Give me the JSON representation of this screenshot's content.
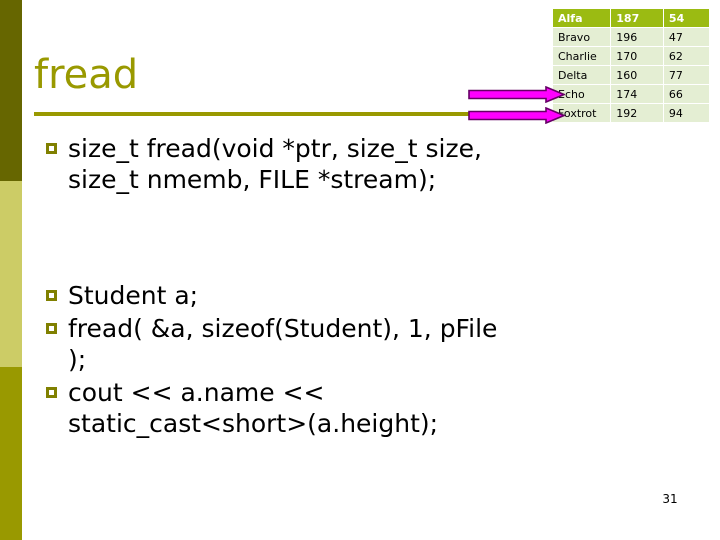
{
  "slide": {
    "title": "fread",
    "page_number": "31"
  },
  "sidebar": {
    "segments": [
      {
        "name": "top",
        "color": "#666600"
      },
      {
        "name": "middle",
        "color": "#CCCC66"
      },
      {
        "name": "bottom",
        "color": "#999900"
      }
    ]
  },
  "content": {
    "groups": [
      {
        "bullets": [
          "size_t fread(void *ptr, size_t size, size_t nmemb, FILE *stream);"
        ]
      },
      {
        "bullets": [
          "Student a;",
          "fread( &a, sizeof(Student), 1, pFile );",
          "cout << a.name << static_cast<short>(a.height);"
        ]
      }
    ]
  },
  "table": {
    "header": [
      "Alfa",
      "187",
      "54"
    ],
    "rows": [
      [
        "Bravo",
        "196",
        "47"
      ],
      [
        "Charlie",
        "170",
        "62"
      ],
      [
        "Delta",
        "160",
        "77"
      ],
      [
        "Echo",
        "174",
        "66"
      ],
      [
        "Foxtrot",
        "192",
        "94"
      ]
    ],
    "header_bg": "#9BBB12",
    "row_bg": "#E4EED3",
    "header_text_color": "#FFFFFF"
  },
  "annotations": {
    "arrows": [
      {
        "name": "arrow-to-echo-row",
        "color": "#FF00FF",
        "outline": "#660066",
        "direction": "right"
      },
      {
        "name": "arrow-to-foxtrot-row",
        "color": "#FF00FF",
        "outline": "#660066",
        "direction": "right"
      }
    ]
  },
  "theme": {
    "title_color": "#999900",
    "bullet_color": "#808000",
    "body_text_color": "#000000",
    "background": "#FFFFFF"
  }
}
